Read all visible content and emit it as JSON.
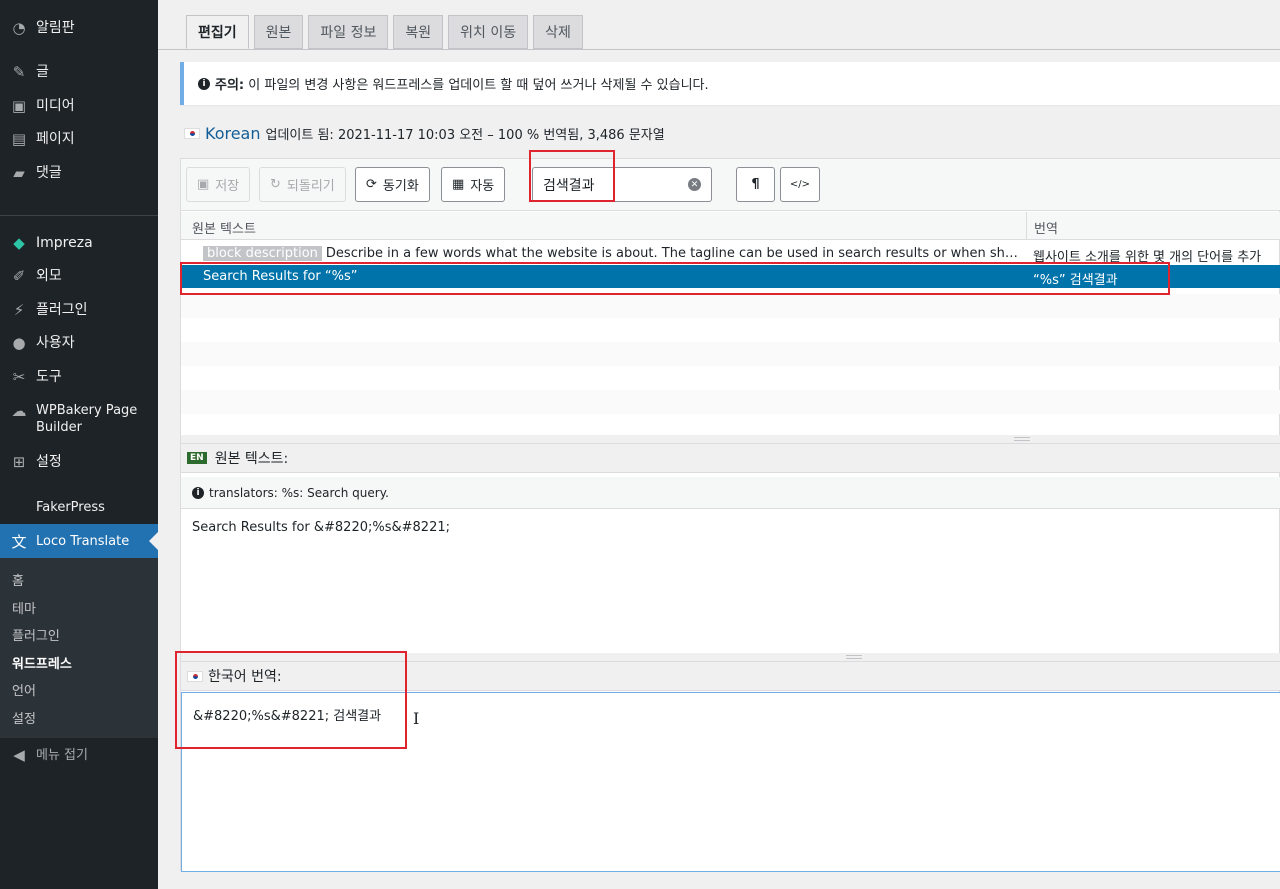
{
  "sidebar": {
    "items": [
      {
        "label": "알림판",
        "icon": "dashboard-icon",
        "glyph": "◔"
      },
      {
        "label": "글",
        "icon": "pin-icon",
        "glyph": "✎"
      },
      {
        "label": "미디어",
        "icon": "media-icon",
        "glyph": "▣"
      },
      {
        "label": "페이지",
        "icon": "page-icon",
        "glyph": "▤"
      },
      {
        "label": "댓글",
        "icon": "comment-icon",
        "glyph": "▰"
      },
      {
        "label": "Impreza",
        "icon": "diamond-icon",
        "glyph": "◆"
      },
      {
        "label": "외모",
        "icon": "brush-icon",
        "glyph": "✐"
      },
      {
        "label": "플러그인",
        "icon": "plugin-icon",
        "glyph": "⚡"
      },
      {
        "label": "사용자",
        "icon": "user-icon",
        "glyph": "●"
      },
      {
        "label": "도구",
        "icon": "wrench-icon",
        "glyph": "✂"
      },
      {
        "label_line1": "WPBakery Page",
        "label_line2": "Builder",
        "icon": "cloud-icon",
        "glyph": "☁"
      },
      {
        "label": "설정",
        "icon": "settings-icon",
        "glyph": "⊞"
      },
      {
        "label": "FakerPress",
        "icon": "none",
        "glyph": ""
      },
      {
        "label": "Loco Translate",
        "icon": "translate-icon",
        "glyph": "文"
      }
    ],
    "submenu": [
      "홈",
      "테마",
      "플러그인",
      "워드프레스",
      "언어",
      "설정"
    ],
    "collapse_label": "메뉴 접기",
    "accent": "#2271b1"
  },
  "tabs": [
    "편집기",
    "원본",
    "파일 정보",
    "복원",
    "위치 이동",
    "삭제"
  ],
  "notice": {
    "label": "주의:",
    "text": "이 파일의 변경 사항은 워드프레스를 업데이트 할 때 덮어 쓰거나 삭제될 수 있습니다."
  },
  "status": {
    "language": "Korean",
    "text": "업데이트 됨: 2021-11-17 10:03 오전 – 100 % 번역됨, 3,486 문자열"
  },
  "toolbar": {
    "save_label": "저장",
    "revert_label": "되돌리기",
    "sync_label": "동기화",
    "auto_label": "자동",
    "search_value": "검색결과",
    "pilcrow_label": "¶",
    "code_label": "</>"
  },
  "list": {
    "col_source": "원본 텍스트",
    "col_translation": "번역",
    "rows": [
      {
        "context": "block description",
        "source": "Describe in a few words what the website is about. The tagline can be used in search results or when sharing on so...",
        "translation": "웹사이트 소개를 위한 몇 개의 단어를 추가"
      },
      {
        "source": "Search Results for “%s”",
        "translation": "“%s” 검색결과"
      }
    ]
  },
  "source_pane": {
    "lang_badge": "EN",
    "title": "원본 텍스트:",
    "comment": "translators: %s: Search query.",
    "text": "Search Results for &#8220;%s&#8221;"
  },
  "translation_pane": {
    "title": "한국어 번역:",
    "text": "&#8220;%s&#8221; 검색결과"
  }
}
